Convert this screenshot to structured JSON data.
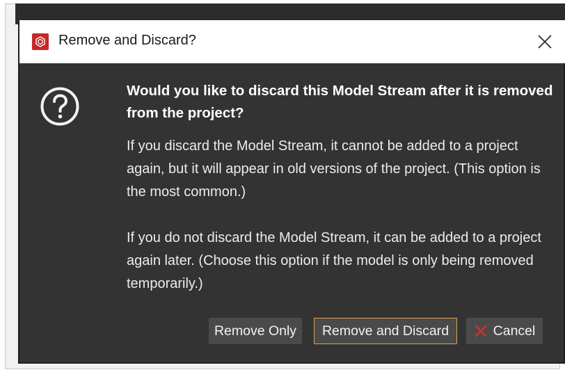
{
  "dialog": {
    "title": "Remove and Discard?",
    "close_icon": "close-icon",
    "app_icon": "app-logo-icon",
    "question_icon": "question-circle-icon",
    "heading": "Would you like to discard this Model Stream after it is removed from the project?",
    "paragraph1": "If you discard the Model Stream, it cannot be added to a project again, but it will appear in old versions of the project. (This option is the most common.)",
    "paragraph2": "If you do not discard the Model Stream, it can be added to a project again later. (Choose this option if the model is only being removed temporarily.)"
  },
  "buttons": {
    "remove_only": "Remove Only",
    "remove_and_discard": "Remove and Discard",
    "cancel": "Cancel",
    "cancel_icon": "x-icon"
  },
  "colors": {
    "dialog_bg": "#333333",
    "button_bg": "#4a4a4a",
    "focused_border": "#e0a050",
    "accent_red": "#c62828"
  }
}
